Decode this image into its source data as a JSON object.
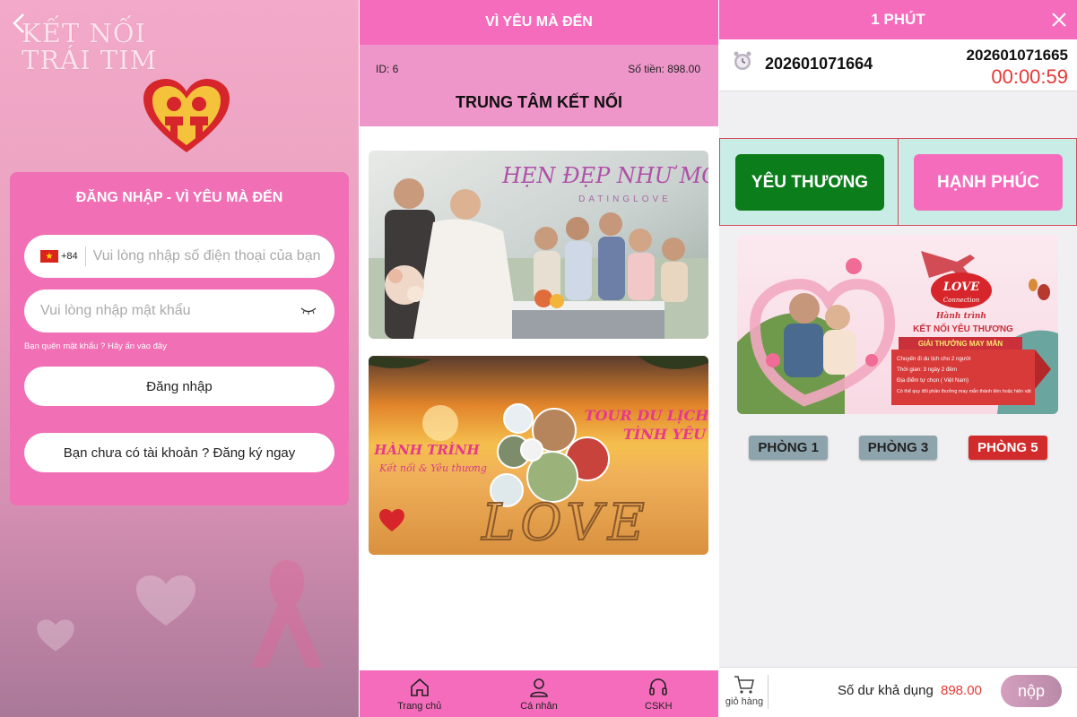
{
  "login": {
    "brand_line1": "KẾT NỐI",
    "brand_line2": "TRÁI TIM",
    "title": "ĐĂNG NHẬP - VÌ YÊU MÀ ĐẾN",
    "country_code": "+84",
    "phone_placeholder": "Vui lòng nhập số điện thoại của bạn",
    "password_placeholder": "Vui lòng nhập mật khẩu",
    "forgot_text": "Bạn quên mật khẩu ? Hãy ấn vào đây",
    "login_label": "Đăng nhập",
    "register_label": "Bạn chưa có tài khoản ? Đăng ký ngay"
  },
  "home": {
    "header_title": "VÌ YÊU MÀ ĐẾN",
    "id_label": "ID: 6",
    "balance_label": "Số tiền: 898.00",
    "center_title": "TRUNG TÂM KẾT NỐI",
    "banner1": {
      "headline": "HẸN ĐẸP NHƯ MƠ",
      "sub": "DATINGLOVE"
    },
    "banner2": {
      "tour_line1": "TOUR DU LỊCH",
      "tour_line2": "TÌNH YÊU",
      "journey": "HÀNH TRÌNH",
      "journey_sub": "Kết nối & Yêu thương",
      "sand": "LOVE"
    },
    "nav": [
      {
        "label": "Trang chủ",
        "icon": "home-icon"
      },
      {
        "label": "Cá nhân",
        "icon": "user-icon"
      },
      {
        "label": "CSKH",
        "icon": "headset-icon"
      }
    ]
  },
  "room": {
    "header_title": "1 PHÚT",
    "session_id": "202601071664",
    "next_session_id": "202601071665",
    "countdown": "00:00:59",
    "choice_left": "YÊU THƯƠNG",
    "choice_right": "HẠNH PHÚC",
    "banner": {
      "badge_line1": "LOVE",
      "badge_line2": "Connection",
      "line1": "Hành trình",
      "line2": "KẾT NỐI YÊU THƯƠNG",
      "prize_title": "GIẢI THƯỞNG MAY MẮN",
      "bullets": [
        "Chuyến đi du lịch cho 2 người",
        "Thời gian: 3 ngày 2 đêm",
        "Địa điểm tự chọn ( Việt Nam)",
        "Có thể quy đổi phần thưởng may mắn thành tiền hoặc hiện vật"
      ]
    },
    "rooms": [
      "PHÒNG 1",
      "PHÒNG 3",
      "PHÒNG 5"
    ],
    "cart_label": "giỏ hàng",
    "balance_label": "Số dư khả dụng",
    "balance_value": "898.00",
    "deposit_label": "nộp"
  },
  "colors": {
    "pink": "#f56cbc",
    "green": "#0b7d1a",
    "red": "#d22b2b",
    "countdown": "#e53935"
  }
}
